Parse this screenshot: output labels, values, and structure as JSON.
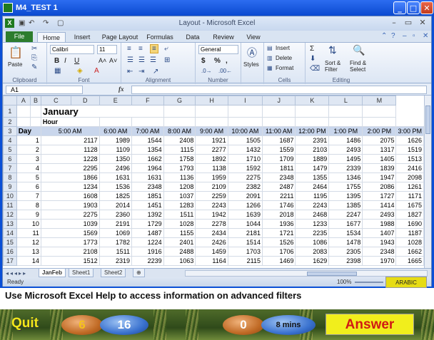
{
  "window": {
    "title": "M4_TEST 1",
    "min_label": "_",
    "max_label": "□",
    "close_label": "✕"
  },
  "excel": {
    "title": "Layout - Microsoft Excel",
    "qat_icons": [
      "save-icon",
      "undo-icon",
      "redo-icon",
      "new-doc-icon"
    ],
    "tabs": [
      "File",
      "Home",
      "Insert",
      "Page Layout",
      "Formulas",
      "Data",
      "Review",
      "View"
    ],
    "ribbon": {
      "clipboard": {
        "label": "Clipboard",
        "paste": "Paste"
      },
      "font": {
        "label": "Font",
        "name": "Calibri",
        "size": "11",
        "bold": "B",
        "italic": "I",
        "underline": "U",
        "grow": "A˄",
        "shrink": "A˅"
      },
      "alignment": {
        "label": "Alignment"
      },
      "number": {
        "label": "Number",
        "format": "General",
        "currency": "$",
        "percent": "%",
        "comma": ","
      },
      "styles": {
        "label": "Styles"
      },
      "cells": {
        "label": "Cells",
        "insert": "Insert",
        "delete": "Delete",
        "format": "Format"
      },
      "editing": {
        "label": "Editing",
        "sum": "Σ",
        "sort": "Sort &",
        "filter": "Filter",
        "find": "Find &",
        "select": "Select"
      }
    },
    "formula_bar": {
      "name_box": "A1",
      "fx": "fx",
      "value": ""
    },
    "columns": [
      "A",
      "B",
      "C",
      "D",
      "E",
      "F",
      "G",
      "H",
      "I",
      "J",
      "K",
      "L",
      "M"
    ],
    "sheet_title": "January",
    "hour_label": "Hour",
    "day_label": "Day",
    "hours": [
      "5:00 AM",
      "6:00 AM",
      "7:00 AM",
      "8:00 AM",
      "9:00 AM",
      "10:00 AM",
      "11:00 AM",
      "12:00 PM",
      "1:00 PM",
      "2:00 PM",
      "3:00 PM"
    ],
    "rows": [
      {
        "row": "4",
        "day": "1",
        "values": [
          "2117",
          "1989",
          "1544",
          "2408",
          "1921",
          "1505",
          "1687",
          "2391",
          "1486",
          "2075",
          "1626"
        ]
      },
      {
        "row": "5",
        "day": "2",
        "values": [
          "1128",
          "1109",
          "1354",
          "1115",
          "2277",
          "1432",
          "1559",
          "2103",
          "2493",
          "1317",
          "1519"
        ]
      },
      {
        "row": "6",
        "day": "3",
        "values": [
          "1228",
          "1350",
          "1662",
          "1758",
          "1892",
          "1710",
          "1709",
          "1889",
          "1495",
          "1405",
          "1513"
        ]
      },
      {
        "row": "7",
        "day": "4",
        "values": [
          "2295",
          "2496",
          "1964",
          "1793",
          "1138",
          "1592",
          "1811",
          "1479",
          "2339",
          "1839",
          "2416"
        ]
      },
      {
        "row": "8",
        "day": "5",
        "values": [
          "1866",
          "1631",
          "1631",
          "1136",
          "1959",
          "2275",
          "2348",
          "1355",
          "1346",
          "1947",
          "2098"
        ]
      },
      {
        "row": "9",
        "day": "6",
        "values": [
          "1234",
          "1536",
          "2348",
          "1208",
          "2109",
          "2382",
          "2487",
          "2464",
          "1755",
          "2086",
          "1261"
        ]
      },
      {
        "row": "10",
        "day": "7",
        "values": [
          "1608",
          "1825",
          "1851",
          "1037",
          "2259",
          "2091",
          "2211",
          "1195",
          "1395",
          "1727",
          "1171"
        ]
      },
      {
        "row": "11",
        "day": "8",
        "values": [
          "1903",
          "2014",
          "1451",
          "1283",
          "2243",
          "1266",
          "1746",
          "2243",
          "1385",
          "1414",
          "1675"
        ]
      },
      {
        "row": "12",
        "day": "9",
        "values": [
          "2275",
          "2360",
          "1392",
          "1511",
          "1942",
          "1639",
          "2018",
          "2468",
          "2247",
          "2493",
          "1827"
        ]
      },
      {
        "row": "13",
        "day": "10",
        "values": [
          "1039",
          "2191",
          "1729",
          "1028",
          "2278",
          "1044",
          "1936",
          "1233",
          "1677",
          "1988",
          "1690"
        ]
      },
      {
        "row": "14",
        "day": "11",
        "values": [
          "1569",
          "1069",
          "1487",
          "1155",
          "2434",
          "2181",
          "1721",
          "2235",
          "1534",
          "1407",
          "1187"
        ]
      },
      {
        "row": "15",
        "day": "12",
        "values": [
          "1773",
          "1782",
          "1224",
          "2401",
          "2426",
          "1514",
          "1526",
          "1086",
          "1478",
          "1943",
          "1028"
        ]
      },
      {
        "row": "16",
        "day": "13",
        "values": [
          "2108",
          "1511",
          "1916",
          "2488",
          "1459",
          "1703",
          "1706",
          "2083",
          "2305",
          "2348",
          "1662"
        ]
      },
      {
        "row": "17",
        "day": "14",
        "values": [
          "1512",
          "2319",
          "2239",
          "1063",
          "1164",
          "2115",
          "1469",
          "1629",
          "2398",
          "1970",
          "1665"
        ]
      }
    ],
    "sheet_tabs": [
      "JanFeb",
      "Sheet1",
      "Sheet2"
    ],
    "status": {
      "ready": "Ready",
      "zoom": "100%"
    }
  },
  "quiz": {
    "arabic": "ARABIC",
    "question": "Use Microsoft Excel Help to access information on advanced filters",
    "quit": "Quit",
    "score_a": "6",
    "score_b": "16",
    "score_c": "0",
    "timer": "8 mins",
    "answer": "Answer"
  }
}
